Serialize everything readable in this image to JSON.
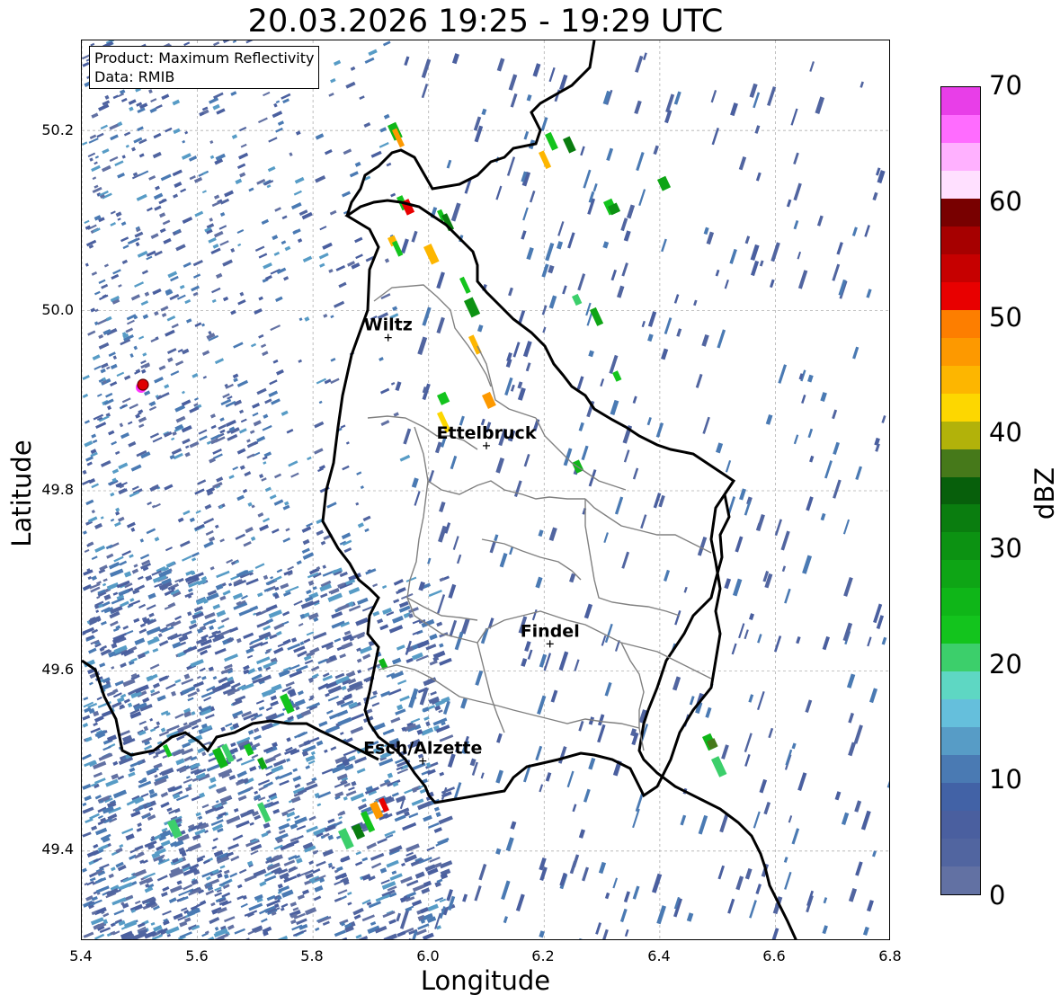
{
  "title": "20.03.2026 19:25 - 19:29 UTC",
  "info_box": {
    "product": "Product: Maximum Reflectivity",
    "data": "Data: RMIB"
  },
  "axes": {
    "xlabel": "Longitude",
    "ylabel": "Latitude",
    "xlim": [
      5.4,
      6.8
    ],
    "ylim": [
      49.3,
      50.3
    ],
    "xticks": [
      "5.4",
      "5.6",
      "5.8",
      "6.0",
      "6.2",
      "6.4",
      "6.6",
      "6.8"
    ],
    "yticks": [
      "49.4",
      "49.6",
      "49.8",
      "50.0",
      "50.2"
    ],
    "grid": true
  },
  "colorbar": {
    "label": "dBZ",
    "ticks": [
      "0",
      "10",
      "20",
      "30",
      "40",
      "50",
      "60",
      "70"
    ],
    "range": [
      0,
      70
    ],
    "colors": [
      "#6271a3",
      "#5165a0",
      "#4a5f9f",
      "#4262a6",
      "#4a7ab3",
      "#579cc6",
      "#65bfdc",
      "#5ed7c3",
      "#3ccf6b",
      "#13c41d",
      "#0fb618",
      "#0ea515",
      "#0c9212",
      "#0a7d0f",
      "#075f0b",
      "#46791a",
      "#b2b20a",
      "#fdd700",
      "#fdb600",
      "#fd9900",
      "#fd7e00",
      "#e80000",
      "#c60000",
      "#a60000",
      "#780000",
      "#ffe0ff",
      "#ffb1ff",
      "#ff6cff",
      "#e83ee8"
    ]
  },
  "places": [
    {
      "name": "Wiltz",
      "lon": 5.93,
      "lat": 49.97
    },
    {
      "name": "Ettelbruck",
      "lon": 6.1,
      "lat": 49.85
    },
    {
      "name": "Findel",
      "lon": 6.21,
      "lat": 49.63
    },
    {
      "name": "Esch/Alzette",
      "lon": 5.99,
      "lat": 49.5
    }
  ],
  "radar_site": {
    "lon": 5.505,
    "lat": 49.915
  }
}
